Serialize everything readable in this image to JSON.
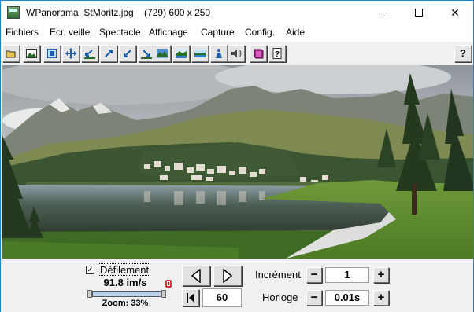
{
  "window": {
    "title": "WPanorama  StMoritz.jpg    (729) 600 x 250",
    "minimize_glyph": "—",
    "close_glyph": "✕"
  },
  "menu": [
    {
      "label": "Fichiers"
    },
    {
      "label": "Ecr. veille"
    },
    {
      "label": "Spectacle"
    },
    {
      "label": "Affichage"
    },
    {
      "label": "Capture"
    },
    {
      "label": "Config."
    },
    {
      "label": "Aide"
    }
  ],
  "toolbar": {
    "icons": [
      "open-folder-icon",
      "landscape-icon",
      "fit-window-icon",
      "move-icon",
      "arrow-left-up-icon",
      "arrow-right-up-icon",
      "arrow-left-down-icon",
      "arrow-right-down-icon",
      "panorama-mountains-icon",
      "panorama-sea-icon",
      "panorama-flat-icon",
      "person-icon",
      "speaker-icon",
      "book-icon",
      "help-doc-icon",
      "help-icon"
    ],
    "help_glyph": "?"
  },
  "controls": {
    "scroll_label": "Défilement",
    "scroll_checked": true,
    "check_glyph": "✓",
    "speed": "91.8 im/s",
    "zoom": "Zoom: 33%",
    "frames": "60",
    "increment_label": "Incrément",
    "increment_value": "1",
    "clock_label": "Horloge",
    "clock_value": "0.01s",
    "minus": "−",
    "plus": "+",
    "left_arrow": "◀",
    "right_arrow": "▶",
    "first_glyph": "⏮"
  }
}
